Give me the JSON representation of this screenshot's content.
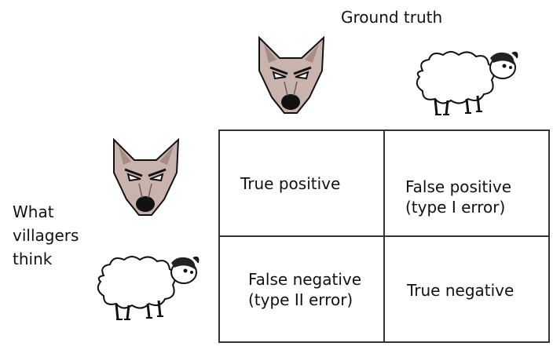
{
  "header": {
    "ground_truth": "Ground truth"
  },
  "row_label": {
    "line1": "What",
    "line2": "villagers",
    "line3": "think"
  },
  "cells": {
    "true_positive": {
      "text": "True positive"
    },
    "false_positive": {
      "line1": "False positive",
      "line2": "(type I error)"
    },
    "false_negative": {
      "line1": "False negative",
      "line2": "(type II error)"
    },
    "true_negative": {
      "text": "True negative"
    }
  },
  "colors": {
    "wolf_fur": "#c9b3ad",
    "wolf_dark": "#6b5a55",
    "sheep_wool": "#ffffff",
    "outline": "#111111"
  }
}
